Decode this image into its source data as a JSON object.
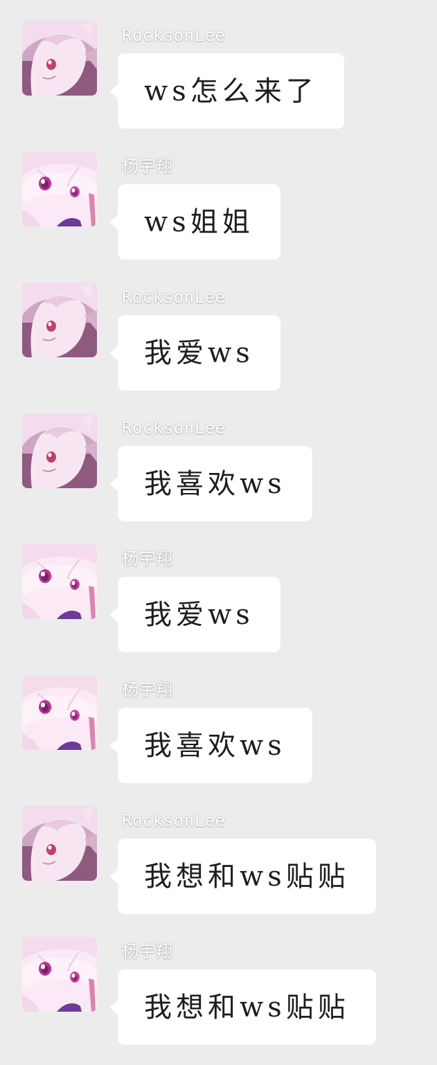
{
  "messages": [
    {
      "sender": "RocksonLee",
      "text": "ws怎么来了",
      "avatar": "rocksonlee-avatar-icon"
    },
    {
      "sender": "杨宇翔",
      "text": "ws姐姐",
      "avatar": "yangyuxiang-avatar-icon"
    },
    {
      "sender": "RocksonLee",
      "text": "我爱ws",
      "avatar": "rocksonlee-avatar-icon"
    },
    {
      "sender": "RocksonLee",
      "text": "我喜欢ws",
      "avatar": "rocksonlee-avatar-icon"
    },
    {
      "sender": "杨宇翔",
      "text": "我爱ws",
      "avatar": "yangyuxiang-avatar-icon"
    },
    {
      "sender": "杨宇翔",
      "text": "我喜欢ws",
      "avatar": "yangyuxiang-avatar-icon"
    },
    {
      "sender": "RocksonLee",
      "text": "我想和ws贴贴",
      "avatar": "rocksonlee-avatar-icon"
    },
    {
      "sender": "杨宇翔",
      "text": "我想和ws贴贴",
      "avatar": "yangyuxiang-avatar-icon"
    }
  ],
  "colors": {
    "background": "#ececec",
    "bubble": "#ffffff",
    "message_text": "#1d1d1d",
    "sender_text": "#ffffff"
  }
}
